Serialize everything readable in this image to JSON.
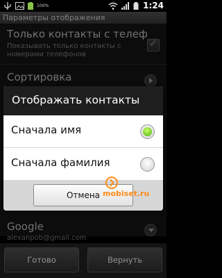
{
  "status_bar": {
    "time": "1:24",
    "icons": [
      "usb-icon",
      "image-icon",
      "battery-full-icon",
      "wifi-icon",
      "signal-icon",
      "battery-icon"
    ],
    "small_text": "100%"
  },
  "title_bar": {
    "title": "Параметры отображения"
  },
  "settings": {
    "only_phones": {
      "title": "Только контакты с телеф",
      "subtitle_line1": "Показывать только контакты с",
      "subtitle_line2": "номерами телефонов",
      "checked": true
    },
    "sort": {
      "title": "Сортировка"
    },
    "account": {
      "title": "Google",
      "email": "alexanpob@gmail.com"
    }
  },
  "dialog": {
    "title": "Отображать контакты",
    "options": [
      {
        "label": "Сначала имя",
        "selected": true
      },
      {
        "label": "Сначала фамилия",
        "selected": false
      }
    ],
    "cancel_label": "Отмена"
  },
  "watermark": {
    "text": "mobiset.ru"
  },
  "bottom_buttons": {
    "done_label": "Готово",
    "revert_label": "Вернуть"
  },
  "colors": {
    "accent_green": "#4fae0a",
    "watermark_orange": "#ff8c1a"
  }
}
